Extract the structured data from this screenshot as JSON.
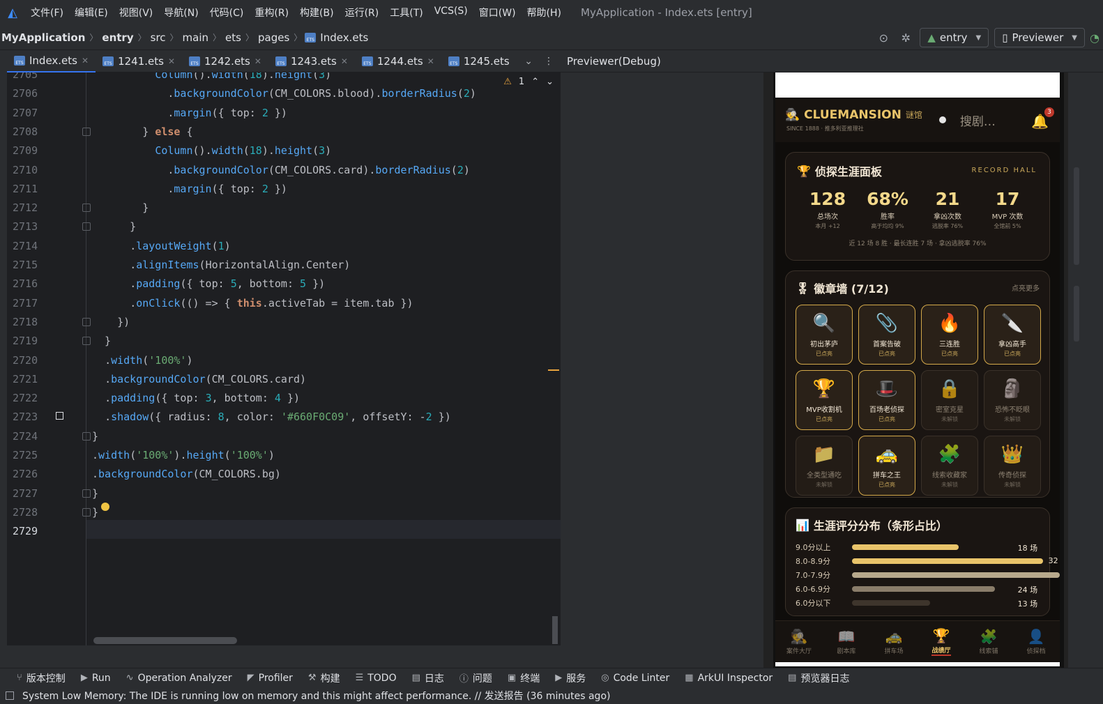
{
  "menu": {
    "items": [
      "文件(F)",
      "编辑(E)",
      "视图(V)",
      "导航(N)",
      "代码(C)",
      "重构(R)",
      "构建(B)",
      "运行(R)",
      "工具(T)",
      "VCS(S)",
      "窗口(W)",
      "帮助(H)"
    ],
    "window_title": "MyApplication - Index.ets [entry]"
  },
  "breadcrumb": [
    "MyApplication",
    "entry",
    "src",
    "main",
    "ets",
    "pages",
    "Index.ets"
  ],
  "nav": {
    "module": "entry",
    "device": "Previewer"
  },
  "tabs": [
    {
      "label": "Index.ets",
      "active": true
    },
    {
      "label": "1241.ets"
    },
    {
      "label": "1242.ets"
    },
    {
      "label": "1243.ets"
    },
    {
      "label": "1244.ets"
    },
    {
      "label": "1245.ets"
    }
  ],
  "editor": {
    "warning_count": "1",
    "lines": [
      {
        "n": "2705",
        "code": "          Column().width(18).height(3)"
      },
      {
        "n": "2706",
        "code": "            .backgroundColor(CM_COLORS.blood).borderRadius(2)"
      },
      {
        "n": "2707",
        "code": "            .margin({ top: 2 })"
      },
      {
        "n": "2708",
        "code": "        } else {"
      },
      {
        "n": "2709",
        "code": "          Column().width(18).height(3)"
      },
      {
        "n": "2710",
        "code": "            .backgroundColor(CM_COLORS.card).borderRadius(2)"
      },
      {
        "n": "2711",
        "code": "            .margin({ top: 2 })"
      },
      {
        "n": "2712",
        "code": "        }"
      },
      {
        "n": "2713",
        "code": "      }"
      },
      {
        "n": "2714",
        "code": "      .layoutWeight(1)"
      },
      {
        "n": "2715",
        "code": "      .alignItems(HorizontalAlign.Center)"
      },
      {
        "n": "2716",
        "code": "      .padding({ top: 5, bottom: 5 })"
      },
      {
        "n": "2717",
        "code": "      .onClick(() => { this.activeTab = item.tab })"
      },
      {
        "n": "2718",
        "code": "    })"
      },
      {
        "n": "2719",
        "code": "  }"
      },
      {
        "n": "2720",
        "code": "  .width('100%')"
      },
      {
        "n": "2721",
        "code": "  .backgroundColor(CM_COLORS.card)"
      },
      {
        "n": "2722",
        "code": "  .padding({ top: 3, bottom: 4 })"
      },
      {
        "n": "2723",
        "code": "  .shadow({ radius: 8, color: '#660F0C09', offsetY: -2 })"
      },
      {
        "n": "2724",
        "code": "}"
      },
      {
        "n": "2725",
        "code": ".width('100%').height('100%')"
      },
      {
        "n": "2726",
        "code": ".backgroundColor(CM_COLORS.bg)"
      },
      {
        "n": "2727",
        "code": "}"
      },
      {
        "n": "2728",
        "code": "}"
      },
      {
        "n": "2729",
        "code": ""
      }
    ]
  },
  "previewer": {
    "title": "Previewer(Debug)",
    "app": {
      "brand": "CLUEMANSION",
      "brand_cn": "谜馆",
      "brand_sub": "SINCE 1888 · 推多利亚推理社",
      "search_placeholder": "搜剧…",
      "notif_count": "3",
      "record": {
        "title": "侦探生涯面板",
        "tag": "RECORD HALL",
        "stats": [
          {
            "value": "128",
            "label": "总场次",
            "sub": "本月 +12"
          },
          {
            "value": "68%",
            "label": "胜率",
            "sub": "高于均均 9%"
          },
          {
            "value": "21",
            "label": "拿凶次数",
            "sub": "逃脱率 76%"
          },
          {
            "value": "17",
            "label": "MVP 次数",
            "sub": "全馆前 5%"
          }
        ],
        "footer": "近 12 场 8 胜 · 最长连胜 7 场 · 拿凶逃脱率 76%"
      },
      "badges": {
        "title": "徽章墙 (7/12)",
        "more": "点亮更多",
        "items": [
          {
            "name": "初出茅庐",
            "status": "已点亮",
            "icon": "🔍",
            "lit": true
          },
          {
            "name": "首案告破",
            "status": "已点亮",
            "icon": "📎",
            "lit": true
          },
          {
            "name": "三连胜",
            "status": "已点亮",
            "icon": "🔥",
            "lit": true
          },
          {
            "name": "拿凶高手",
            "status": "已点亮",
            "icon": "🔪",
            "lit": true
          },
          {
            "name": "MVP收割机",
            "status": "已点亮",
            "icon": "🏆",
            "lit": true
          },
          {
            "name": "百场老侦探",
            "status": "已点亮",
            "icon": "🎩",
            "lit": true
          },
          {
            "name": "密室克星",
            "status": "未解锁",
            "icon": "🔒",
            "lit": false
          },
          {
            "name": "恐怖不眨眼",
            "status": "未解锁",
            "icon": "🗿",
            "lit": false
          },
          {
            "name": "全类型通吃",
            "status": "未解锁",
            "icon": "📁",
            "lit": false
          },
          {
            "name": "拼车之王",
            "status": "已点亮",
            "icon": "🚕",
            "lit": true
          },
          {
            "name": "线索收藏家",
            "status": "未解锁",
            "icon": "🧩",
            "lit": false
          },
          {
            "name": "传奇侦探",
            "status": "未解锁",
            "icon": "👑",
            "lit": false
          }
        ]
      },
      "distribution": {
        "title": "生涯评分分布（条形占比）",
        "rows": [
          {
            "label": "9.0分以上",
            "count": "18 场",
            "fraction": 0.56,
            "color": "#e9c46a"
          },
          {
            "label": "8.0-8.9分",
            "count": "32",
            "fraction": 1.0,
            "color": "#e9c46a"
          },
          {
            "label": "7.0-7.9分",
            "count": "",
            "fraction": 1.18,
            "color": "#b8a98c"
          },
          {
            "label": "6.0-6.9分",
            "count": "24 场",
            "fraction": 0.75,
            "color": "#8a7d6a"
          },
          {
            "label": "6.0分以下",
            "count": "13 场",
            "fraction": 0.41,
            "color": "#3e352c"
          }
        ]
      },
      "bottom_tabs": [
        {
          "label": "案件大厅",
          "icon": "🕵"
        },
        {
          "label": "剧本库",
          "icon": "📖"
        },
        {
          "label": "拼车场",
          "icon": "🚕"
        },
        {
          "label": "战绩厅",
          "icon": "🏆",
          "active": true
        },
        {
          "label": "线索铺",
          "icon": "🧩"
        },
        {
          "label": "侦探档",
          "icon": "👤"
        }
      ]
    }
  },
  "toolwindows": [
    "版本控制",
    "Run",
    "Operation Analyzer",
    "Profiler",
    "构建",
    "TODO",
    "日志",
    "问题",
    "终端",
    "服务",
    "Code Linter",
    "ArkUI Inspector",
    "预览器日志"
  ],
  "status": "System Low Memory: The IDE is running low on memory and this might affect performance. // 发送报告 (36 minutes ago)"
}
